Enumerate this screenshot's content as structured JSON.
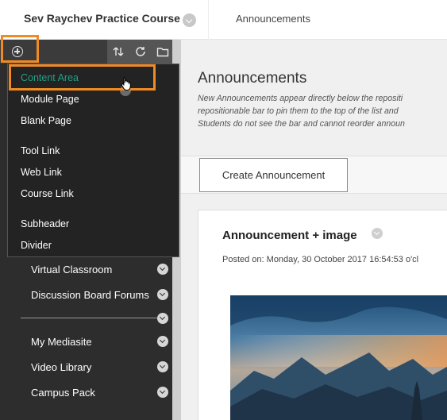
{
  "header": {
    "course_title": "Sev Raychev Practice Course",
    "breadcrumb": "Announcements"
  },
  "sidebar": {
    "toolbar": {
      "add_icon": "plus-circle-icon",
      "sort_icon": "sort-arrows-icon",
      "refresh_icon": "refresh-icon",
      "folder_icon": "folder-icon"
    },
    "add_menu": {
      "groups": [
        [
          "Content Area",
          "Module Page",
          "Blank Page"
        ],
        [
          "Tool Link",
          "Web Link",
          "Course Link"
        ],
        [
          "Subheader",
          "Divider"
        ]
      ],
      "active_item": "Content Area",
      "active_color": "#1fa187"
    },
    "course_menu_items": [
      "Virtual Classroom",
      "Discussion Board Forums",
      "My Mediasite",
      "Video Library",
      "Campus Pack"
    ]
  },
  "main": {
    "title": "Announcements",
    "description_lines": [
      "New Announcements appear directly below the repositi",
      "repositionable bar to pin them to the top of the list and",
      "Students do not see the bar and cannot reorder announ"
    ],
    "create_button": "Create Announcement",
    "announcement": {
      "title": "Announcement + image",
      "posted": "Posted on: Monday, 30 October 2017 16:54:53 o'cl"
    }
  },
  "colors": {
    "highlight": "#f08a24",
    "sidebar_bg": "#2d2d2d"
  }
}
